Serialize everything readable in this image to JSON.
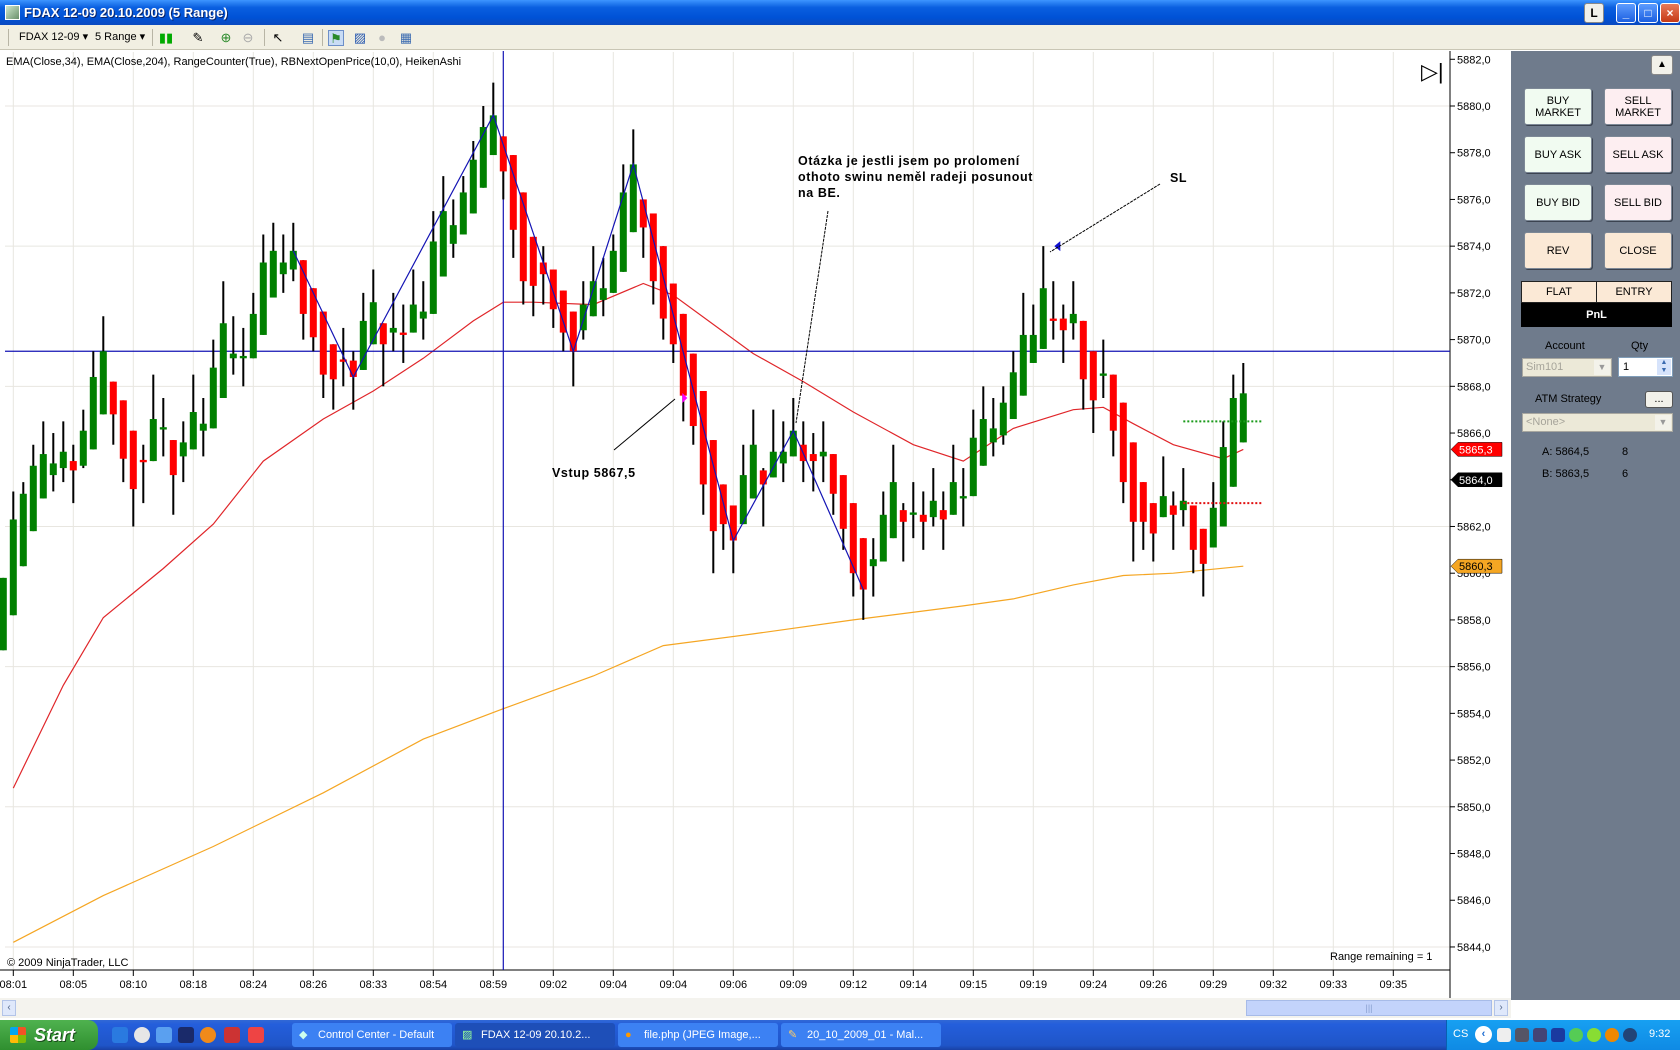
{
  "window": {
    "title": "FDAX 12-09  20.10.2009 (5 Range)",
    "buttons": [
      "L",
      "_",
      "□",
      "×"
    ]
  },
  "toolbar": {
    "instrument": "FDAX 12-09",
    "period": "5 Range",
    "dropdown_glyph": "▾",
    "icons": [
      "candlestick-style-icon",
      "drawing-pencil-icon",
      "zoom-in-icon",
      "zoom-out-icon",
      "cursor-pointer-icon",
      "data-box-icon",
      "strategy-icon",
      "indicators-icon",
      "globex-icon",
      "properties-icon"
    ]
  },
  "chart": {
    "indicator_label": "EMA(Close,34), EMA(Close,204), RangeCounter(True), RBNextOpenPrice(10,0), HeikenAshi",
    "copyright": "© 2009 NinjaTrader, LLC",
    "range_remaining": "Range remaining = 1",
    "colors": {
      "up": "#008000",
      "down": "#ff0000",
      "ema34": "#e0262a",
      "ema204": "#f5a623",
      "lines": "#1414b4"
    },
    "annotations": {
      "entry": "Vstup 5867,5",
      "question": [
        "Otázka je jestli jsem po prolomení",
        "othoto swinu neměl radeji posunout",
        "na BE."
      ],
      "stop": "SL"
    },
    "price_markers": [
      {
        "label": "5865,3",
        "value": 5865.3,
        "color": "#ff0000"
      },
      {
        "label": "5864,0",
        "value": 5864.0,
        "color": "#000000"
      },
      {
        "label": "5860,3",
        "value": 5860.3,
        "color": "#f5a623"
      }
    ]
  },
  "chart_data": {
    "type": "candlestick",
    "style": "HeikenAshi",
    "ylim": [
      5843,
      5882.5
    ],
    "y_ticks": [
      "5882,0",
      "5880,0",
      "5878,0",
      "5876,0",
      "5874,0",
      "5872,0",
      "5870,0",
      "5868,0",
      "5866,0",
      "5864,0",
      "5862,0",
      "5860,0",
      "5858,0",
      "5856,0",
      "5854,0",
      "5852,0",
      "5850,0",
      "5848,0",
      "5846,0",
      "5844,0"
    ],
    "x_ticks": [
      "08:01",
      "08:05",
      "08:10",
      "08:18",
      "08:24",
      "08:26",
      "08:33",
      "08:54",
      "08:59",
      "09:02",
      "09:04",
      "09:04",
      "09:06",
      "09:09",
      "09:12",
      "09:14",
      "09:15",
      "09:19",
      "09:24",
      "09:26",
      "09:29",
      "09:32",
      "09:33",
      "09:35"
    ],
    "ohlc": [
      [
        5856.7,
        5859.8,
        5856.7,
        5859.8
      ],
      [
        5858.2,
        5863.5,
        5858.2,
        5862.3
      ],
      [
        5860.3,
        5863.9,
        5860.3,
        5863.4
      ],
      [
        5861.8,
        5865.5,
        5861.8,
        5864.6
      ],
      [
        5863.2,
        5866.5,
        5863.2,
        5865.1
      ],
      [
        5864.2,
        5866.0,
        5863.5,
        5864.7
      ],
      [
        5864.5,
        5866.5,
        5863.9,
        5865.2
      ],
      [
        5864.8,
        5865.5,
        5863.0,
        5864.4
      ],
      [
        5864.6,
        5867.0,
        5864.5,
        5866.1
      ],
      [
        5865.3,
        5869.5,
        5865.3,
        5868.4
      ],
      [
        5866.8,
        5871.0,
        5866.8,
        5869.5
      ],
      [
        5868.2,
        5868.2,
        5865.5,
        5866.8
      ],
      [
        5867.4,
        5867.4,
        5863.9,
        5864.9
      ],
      [
        5866.1,
        5866.1,
        5862.0,
        5863.6
      ],
      [
        5864.85,
        5865.5,
        5863.0,
        5864.75
      ],
      [
        5864.8,
        5868.5,
        5864.8,
        5866.6
      ],
      [
        5866.15,
        5867.5,
        5865.0,
        5866.25
      ],
      [
        5865.7,
        5865.7,
        5862.5,
        5864.2
      ],
      [
        5865.0,
        5866.5,
        5863.9,
        5865.6
      ],
      [
        5865.3,
        5868.5,
        5865.3,
        5866.9
      ],
      [
        5866.1,
        5867.5,
        5865.0,
        5866.4
      ],
      [
        5866.2,
        5870.0,
        5866.2,
        5868.8
      ],
      [
        5867.5,
        5872.5,
        5867.5,
        5870.7
      ],
      [
        5869.2,
        5871.0,
        5868.5,
        5869.4
      ],
      [
        5869.2,
        5870.5,
        5868.0,
        5869.3
      ],
      [
        5869.2,
        5872.0,
        5869.2,
        5871.1
      ],
      [
        5870.2,
        5874.5,
        5870.2,
        5873.3
      ],
      [
        5871.8,
        5875.0,
        5871.8,
        5873.8
      ],
      [
        5872.8,
        5874.5,
        5872.0,
        5873.3
      ],
      [
        5873.0,
        5875.0,
        5872.5,
        5873.8
      ],
      [
        5873.4,
        5873.4,
        5870.0,
        5871.1
      ],
      [
        5872.2,
        5872.2,
        5869.5,
        5870.1
      ],
      [
        5871.2,
        5871.2,
        5867.5,
        5868.5
      ],
      [
        5869.8,
        5869.8,
        5867.0,
        5868.3
      ],
      [
        5869.15,
        5870.5,
        5868.0,
        5869.05
      ],
      [
        5869.1,
        5869.5,
        5867.0,
        5868.4
      ],
      [
        5868.7,
        5872.0,
        5868.7,
        5870.8
      ],
      [
        5869.8,
        5873.0,
        5869.8,
        5871.6
      ],
      [
        5870.7,
        5870.7,
        5868.0,
        5869.8
      ],
      [
        5870.3,
        5872.0,
        5869.5,
        5870.5
      ],
      [
        5870.3,
        5871.5,
        5869.0,
        5870.2
      ],
      [
        5870.3,
        5873.0,
        5870.3,
        5871.5
      ],
      [
        5870.9,
        5872.5,
        5870.0,
        5871.2
      ],
      [
        5871.1,
        5875.5,
        5871.1,
        5874.2
      ],
      [
        5872.7,
        5877.0,
        5872.7,
        5875.5
      ],
      [
        5874.1,
        5876.0,
        5873.5,
        5874.9
      ],
      [
        5874.5,
        5877.0,
        5874.5,
        5876.3
      ],
      [
        5875.4,
        5878.5,
        5875.4,
        5877.7
      ],
      [
        5876.5,
        5880.0,
        5876.5,
        5879.1
      ],
      [
        5877.9,
        5881.0,
        5877.9,
        5879.6
      ],
      [
        5878.7,
        5878.7,
        5876.0,
        5877.2
      ],
      [
        5877.9,
        5877.9,
        5873.5,
        5874.7
      ],
      [
        5876.3,
        5876.3,
        5871.5,
        5872.5
      ],
      [
        5874.4,
        5874.4,
        5871.0,
        5872.3
      ],
      [
        5873.3,
        5874.0,
        5871.5,
        5872.8
      ],
      [
        5873.0,
        5873.0,
        5870.5,
        5871.3
      ],
      [
        5872.1,
        5872.1,
        5869.5,
        5870.3
      ],
      [
        5871.2,
        5871.2,
        5868.0,
        5869.5
      ],
      [
        5870.4,
        5872.5,
        5870.0,
        5871.5
      ],
      [
        5871.0,
        5874.0,
        5871.0,
        5872.5
      ],
      [
        5871.7,
        5873.5,
        5871.0,
        5872.2
      ],
      [
        5872.0,
        5874.5,
        5872.0,
        5873.8
      ],
      [
        5872.9,
        5877.5,
        5872.9,
        5876.3
      ],
      [
        5874.6,
        5879.0,
        5874.6,
        5877.5
      ],
      [
        5876.0,
        5876.0,
        5873.5,
        5874.8
      ],
      [
        5875.4,
        5875.4,
        5871.5,
        5872.5
      ],
      [
        5874.0,
        5874.0,
        5870.0,
        5870.9
      ],
      [
        5872.4,
        5872.4,
        5869.0,
        5869.8
      ],
      [
        5871.1,
        5871.1,
        5866.5,
        5867.6
      ],
      [
        5869.4,
        5869.4,
        5865.5,
        5866.3
      ],
      [
        5867.8,
        5867.8,
        5862.5,
        5863.8
      ],
      [
        5865.7,
        5865.7,
        5860.0,
        5861.8
      ],
      [
        5863.8,
        5863.8,
        5861.0,
        5862.1
      ],
      [
        5862.9,
        5862.9,
        5860.0,
        5861.4
      ],
      [
        5862.1,
        5865.5,
        5862.1,
        5864.2
      ],
      [
        5863.2,
        5867.0,
        5863.2,
        5865.5
      ],
      [
        5864.4,
        5864.5,
        5862.0,
        5863.8
      ],
      [
        5864.1,
        5867.0,
        5864.1,
        5865.2
      ],
      [
        5864.7,
        5866.5,
        5863.9,
        5865.2
      ],
      [
        5865.0,
        5867.5,
        5865.0,
        5866.1
      ],
      [
        5865.5,
        5866.5,
        5863.9,
        5864.8
      ],
      [
        5865.1,
        5866.0,
        5863.5,
        5864.8
      ],
      [
        5865.0,
        5866.5,
        5863.9,
        5865.2
      ],
      [
        5865.1,
        5865.1,
        5862.5,
        5863.4
      ],
      [
        5864.2,
        5864.2,
        5861.0,
        5861.9
      ],
      [
        5863.0,
        5863.0,
        5859.0,
        5860.0
      ],
      [
        5861.5,
        5861.5,
        5858.0,
        5859.3
      ],
      [
        5860.3,
        5861.5,
        5859.0,
        5860.6
      ],
      [
        5860.5,
        5863.5,
        5860.5,
        5862.5
      ],
      [
        5861.5,
        5865.5,
        5861.5,
        5863.9
      ],
      [
        5862.7,
        5863.0,
        5860.5,
        5862.2
      ],
      [
        5862.5,
        5863.9,
        5861.5,
        5862.6
      ],
      [
        5862.5,
        5863.5,
        5861.0,
        5862.2
      ],
      [
        5862.4,
        5864.5,
        5862.0,
        5863.1
      ],
      [
        5862.7,
        5863.5,
        5861.0,
        5862.3
      ],
      [
        5862.5,
        5865.5,
        5862.5,
        5863.9
      ],
      [
        5863.2,
        5864.5,
        5862.0,
        5863.3
      ],
      [
        5863.3,
        5867.0,
        5863.3,
        5865.8
      ],
      [
        5864.6,
        5868.0,
        5864.6,
        5866.6
      ],
      [
        5865.6,
        5867.5,
        5865.0,
        5866.2
      ],
      [
        5865.9,
        5868.0,
        5865.5,
        5867.3
      ],
      [
        5866.6,
        5869.5,
        5866.6,
        5868.6
      ],
      [
        5867.6,
        5872.0,
        5867.6,
        5870.2
      ],
      [
        5869.0,
        5871.5,
        5869.0,
        5870.2
      ],
      [
        5869.6,
        5874.0,
        5869.6,
        5872.2
      ],
      [
        5870.9,
        5872.5,
        5870.0,
        5870.8
      ],
      [
        5870.9,
        5871.5,
        5869.0,
        5870.4
      ],
      [
        5870.7,
        5872.5,
        5870.0,
        5871.1
      ],
      [
        5870.8,
        5870.8,
        5867.0,
        5868.3
      ],
      [
        5869.5,
        5869.5,
        5866.0,
        5867.4
      ],
      [
        5868.45,
        5870.0,
        5867.5,
        5868.55
      ],
      [
        5868.5,
        5868.5,
        5865.0,
        5866.1
      ],
      [
        5867.3,
        5867.3,
        5863.0,
        5863.9
      ],
      [
        5865.6,
        5865.6,
        5860.5,
        5862.2
      ],
      [
        5863.9,
        5863.9,
        5861.0,
        5862.2
      ],
      [
        5863.0,
        5863.0,
        5860.5,
        5861.7
      ],
      [
        5862.4,
        5865.0,
        5862.4,
        5863.3
      ],
      [
        5862.9,
        5863.5,
        5861.0,
        5862.5
      ],
      [
        5862.7,
        5864.5,
        5862.0,
        5863.1
      ],
      [
        5862.9,
        5862.9,
        5860.0,
        5861.0
      ],
      [
        5861.9,
        5861.9,
        5859.0,
        5860.4
      ],
      [
        5861.1,
        5863.9,
        5861.1,
        5862.8
      ],
      [
        5862.0,
        5866.5,
        5862.0,
        5865.4
      ],
      [
        5863.7,
        5868.5,
        5863.7,
        5867.5
      ],
      [
        5865.6,
        5869.0,
        5865.6,
        5867.7
      ]
    ],
    "ema34": [
      [
        2,
        5850.8
      ],
      [
        7,
        5855.2
      ],
      [
        11,
        5858.1
      ],
      [
        17,
        5860.2
      ],
      [
        22,
        5862.1
      ],
      [
        27,
        5864.8
      ],
      [
        33,
        5866.6
      ],
      [
        38,
        5867.8
      ],
      [
        43,
        5869.2
      ],
      [
        48,
        5870.8
      ],
      [
        51,
        5871.6
      ],
      [
        54,
        5871.6
      ],
      [
        60,
        5871.5
      ],
      [
        65,
        5872.4
      ],
      [
        68,
        5871.9
      ],
      [
        76,
        5869.4
      ],
      [
        81,
        5868.2
      ],
      [
        86,
        5866.9
      ],
      [
        92,
        5865.5
      ],
      [
        97,
        5864.8
      ],
      [
        102,
        5866.2
      ],
      [
        108,
        5867.0
      ],
      [
        111,
        5867.1
      ],
      [
        114,
        5866.4
      ],
      [
        118,
        5865.5
      ],
      [
        123,
        5864.9
      ],
      [
        125,
        5865.3
      ]
    ],
    "ema204": [
      [
        2,
        5844.2
      ],
      [
        11,
        5846.2
      ],
      [
        22,
        5848.3
      ],
      [
        33,
        5850.6
      ],
      [
        43,
        5852.9
      ],
      [
        51,
        5854.2
      ],
      [
        60,
        5855.6
      ],
      [
        67,
        5856.9
      ],
      [
        76,
        5857.4
      ],
      [
        86,
        5858.0
      ],
      [
        97,
        5858.6
      ],
      [
        102,
        5858.9
      ],
      [
        108,
        5859.5
      ],
      [
        113,
        5859.9
      ],
      [
        118,
        5860.0
      ],
      [
        125,
        5860.3
      ]
    ],
    "zigzag": [
      [
        30,
        5873.8
      ],
      [
        36,
        5868.4
      ],
      [
        50,
        5879.6
      ],
      [
        58,
        5869.5
      ],
      [
        64,
        5877.5
      ],
      [
        74,
        5861.4
      ],
      [
        80,
        5866.1
      ],
      [
        87,
        5859.3
      ]
    ],
    "horizontal_line": 5869.5,
    "crosshair_bar": 51,
    "next_open_up": {
      "value": 5866.5,
      "from_bar": 119,
      "to_bar": 127
    },
    "next_open_down": {
      "value": 5863.0,
      "from_bar": 119,
      "to_bar": 127
    },
    "entry_marker": {
      "bar": 69,
      "value": 5867.5
    },
    "stop_marker": {
      "bar": 106,
      "value": 5874.0
    }
  },
  "panel": {
    "buttons": [
      {
        "label": "BUY\nMARKET",
        "kind": "buy"
      },
      {
        "label": "SELL\nMARKET",
        "kind": "sell"
      },
      {
        "label": "BUY ASK",
        "kind": "buy"
      },
      {
        "label": "SELL ASK",
        "kind": "sell"
      },
      {
        "label": "BUY BID",
        "kind": "buy"
      },
      {
        "label": "SELL BID",
        "kind": "sell"
      },
      {
        "label": "REV",
        "kind": "rev"
      },
      {
        "label": "CLOSE",
        "kind": "rev"
      }
    ],
    "position": "FLAT",
    "entry": "ENTRY",
    "pnl": "PnL",
    "account_label": "Account",
    "account_value": "Sim101",
    "qty_label": "Qty",
    "qty_value": "1",
    "atm_label": "ATM Strategy",
    "atm_button": "...",
    "atm_value": "<None>",
    "ask": "A: 5864,5",
    "ask_size": "8",
    "bid": "B: 5863,5",
    "bid_size": "6"
  },
  "taskbar": {
    "start": "Start",
    "tasks": [
      "Control Center - Default",
      "FDAX 12-09  20.10.2...",
      "file.php (JPEG Image,...",
      "20_10_2009_01 - Mal..."
    ],
    "active_task": 1,
    "language": "CS",
    "clock": "9:32"
  }
}
